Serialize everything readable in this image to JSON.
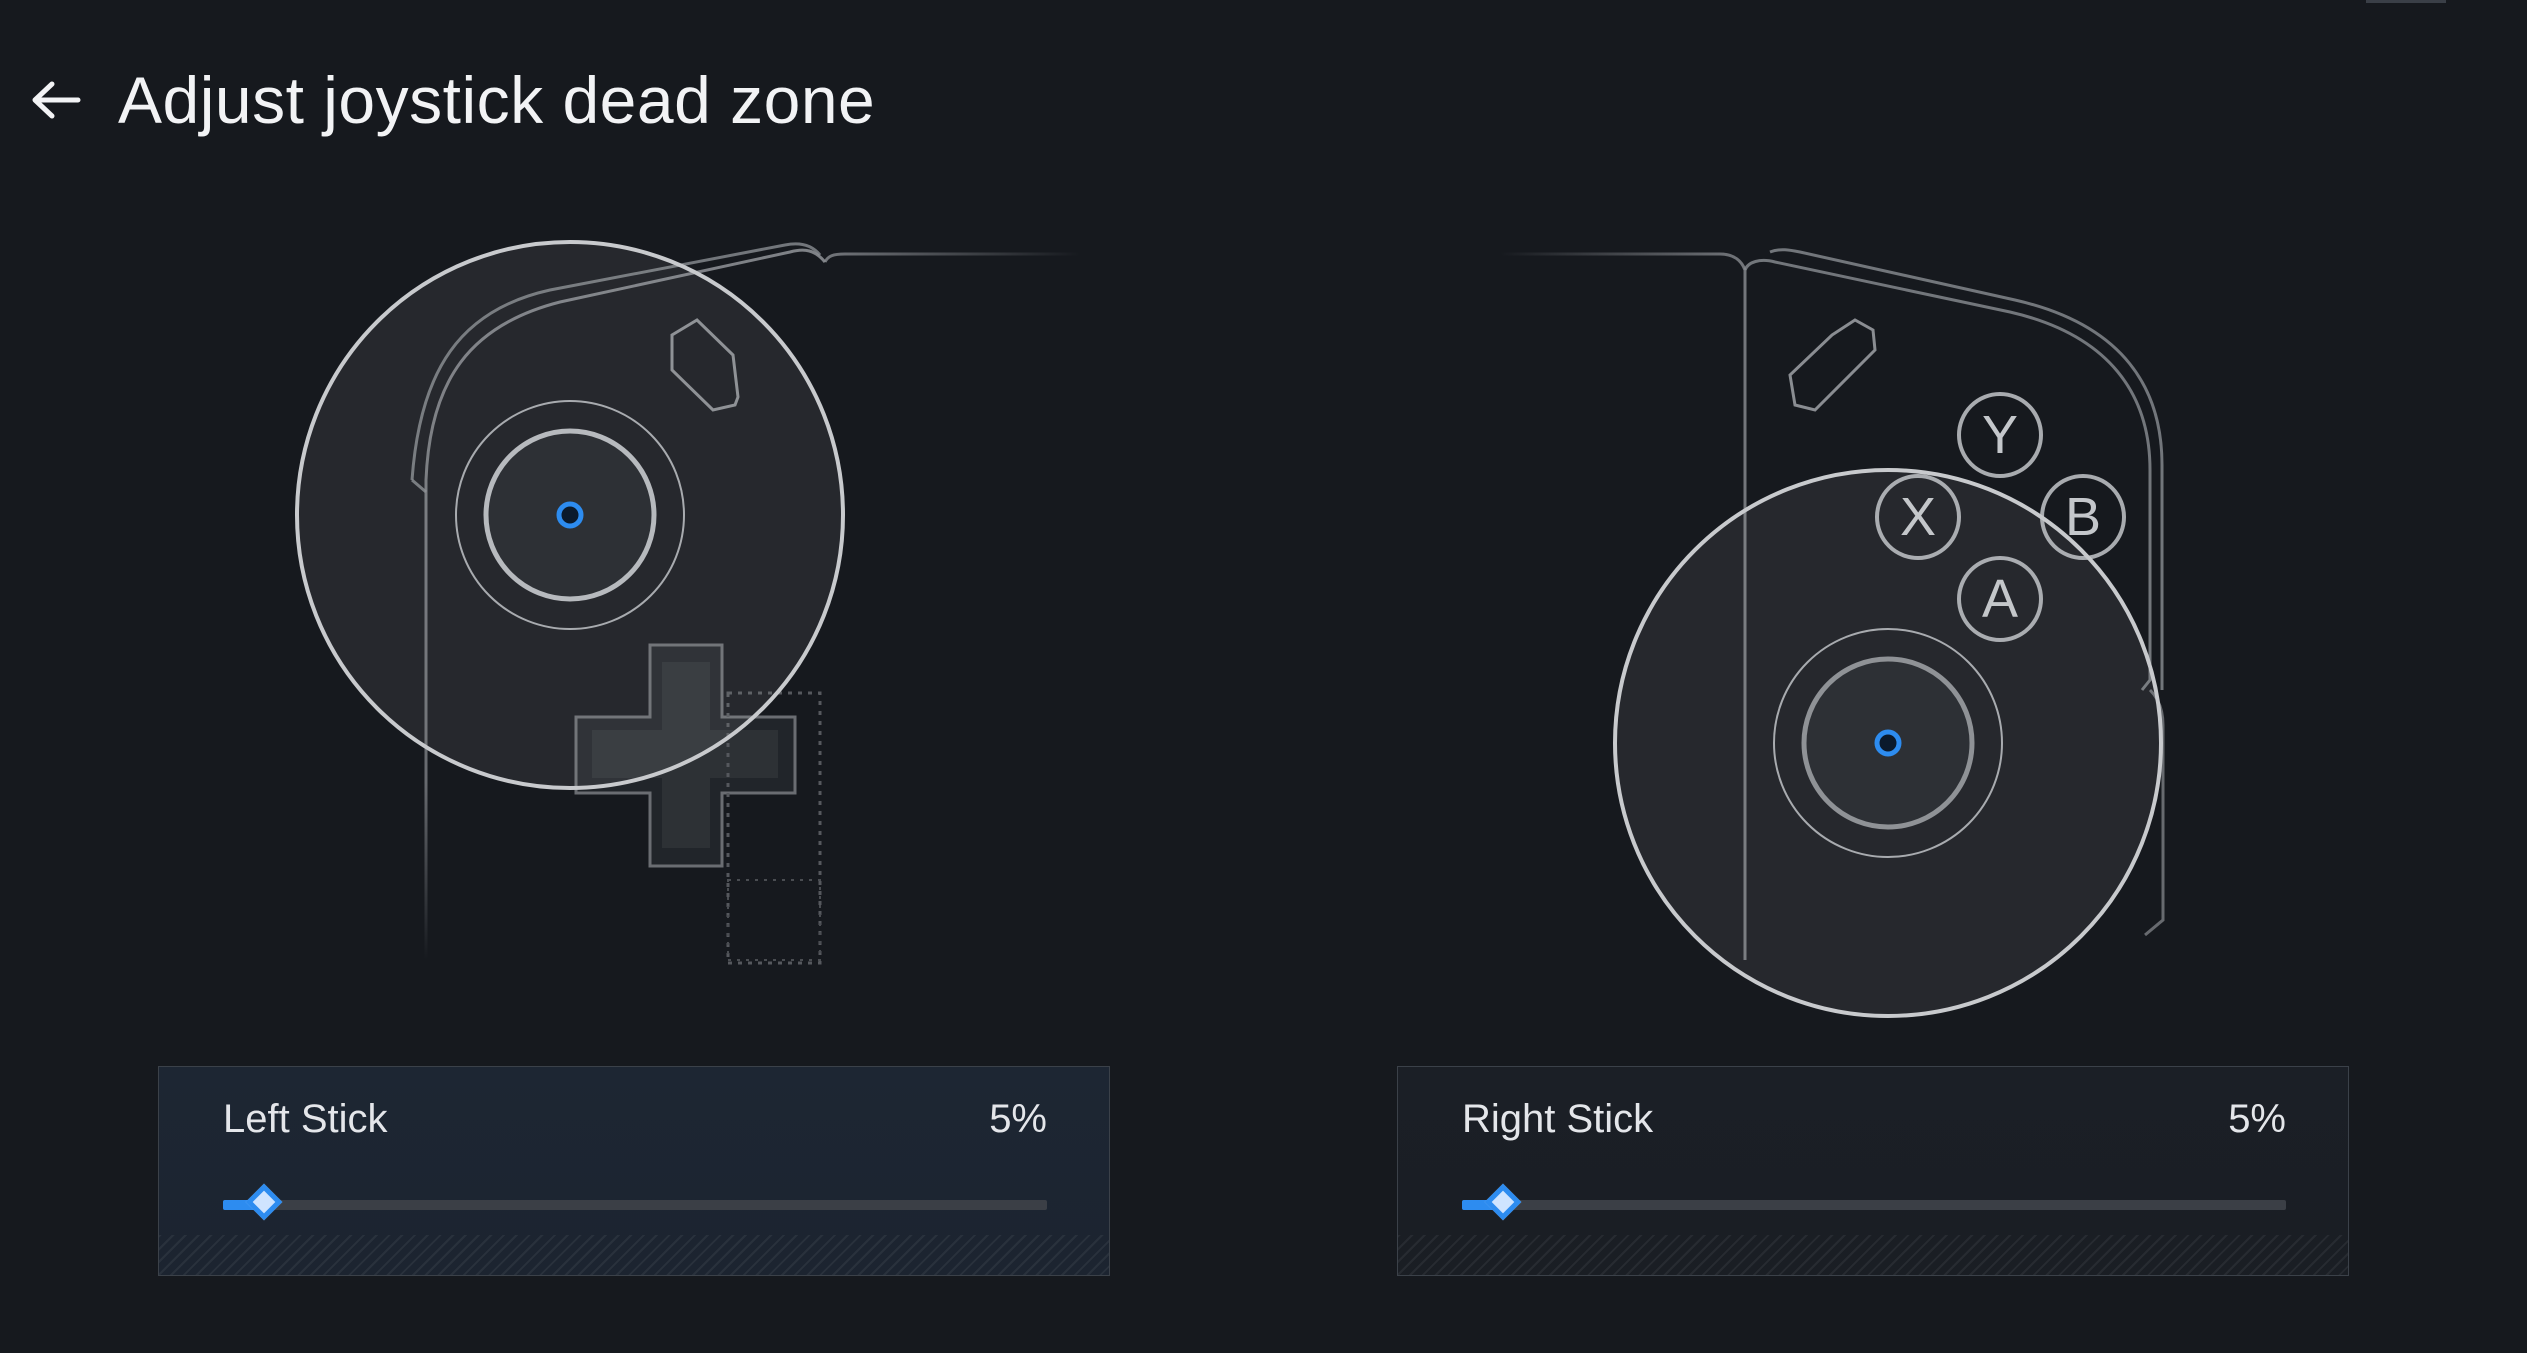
{
  "header": {
    "title": "Adjust joystick dead zone"
  },
  "controller": {
    "face_buttons": [
      "Y",
      "X",
      "B",
      "A"
    ]
  },
  "left_stick": {
    "label": "Left Stick",
    "value_text": "5%",
    "value": 0.05
  },
  "right_stick": {
    "label": "Right Stick",
    "value_text": "5%",
    "value": 0.05
  },
  "colors": {
    "background": "#16191e",
    "accent": "#2d8cf0",
    "outline": "#c8cacd"
  }
}
